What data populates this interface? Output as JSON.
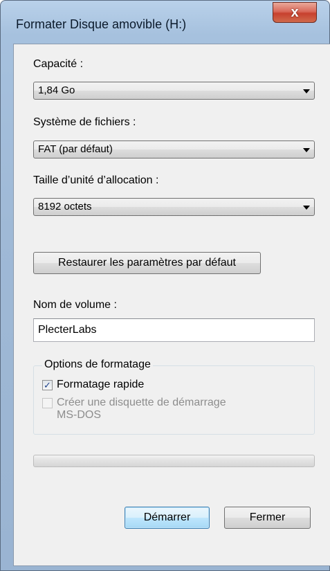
{
  "window": {
    "title": "Formater Disque amovible (H:)",
    "close_glyph": "x"
  },
  "capacity": {
    "label": "Capacité :",
    "value": "1,84 Go"
  },
  "filesystem": {
    "label": "Système de fichiers :",
    "value": "FAT (par défaut)"
  },
  "allocation": {
    "label": "Taille d’unité d’allocation :",
    "value": "8192 octets"
  },
  "restore_button": {
    "label": "Restaurer les paramètres par défaut"
  },
  "volume": {
    "label": "Nom de volume :",
    "value": "PlecterLabs"
  },
  "options": {
    "legend": "Options de formatage",
    "quick_format": {
      "label": "Formatage rapide",
      "checked": true
    },
    "msdos_startup": {
      "label_line1": "Créer une disquette de démarrage",
      "label_line2": "MS-DOS",
      "checked": false,
      "enabled": false
    }
  },
  "progress": {
    "fraction": 0
  },
  "footer": {
    "start_label": "Démarrer",
    "close_label": "Fermer"
  },
  "colors": {
    "accent_button_border": "#3c7fb1",
    "close_button": "#c7402e",
    "progress_fill": "#06b025"
  }
}
